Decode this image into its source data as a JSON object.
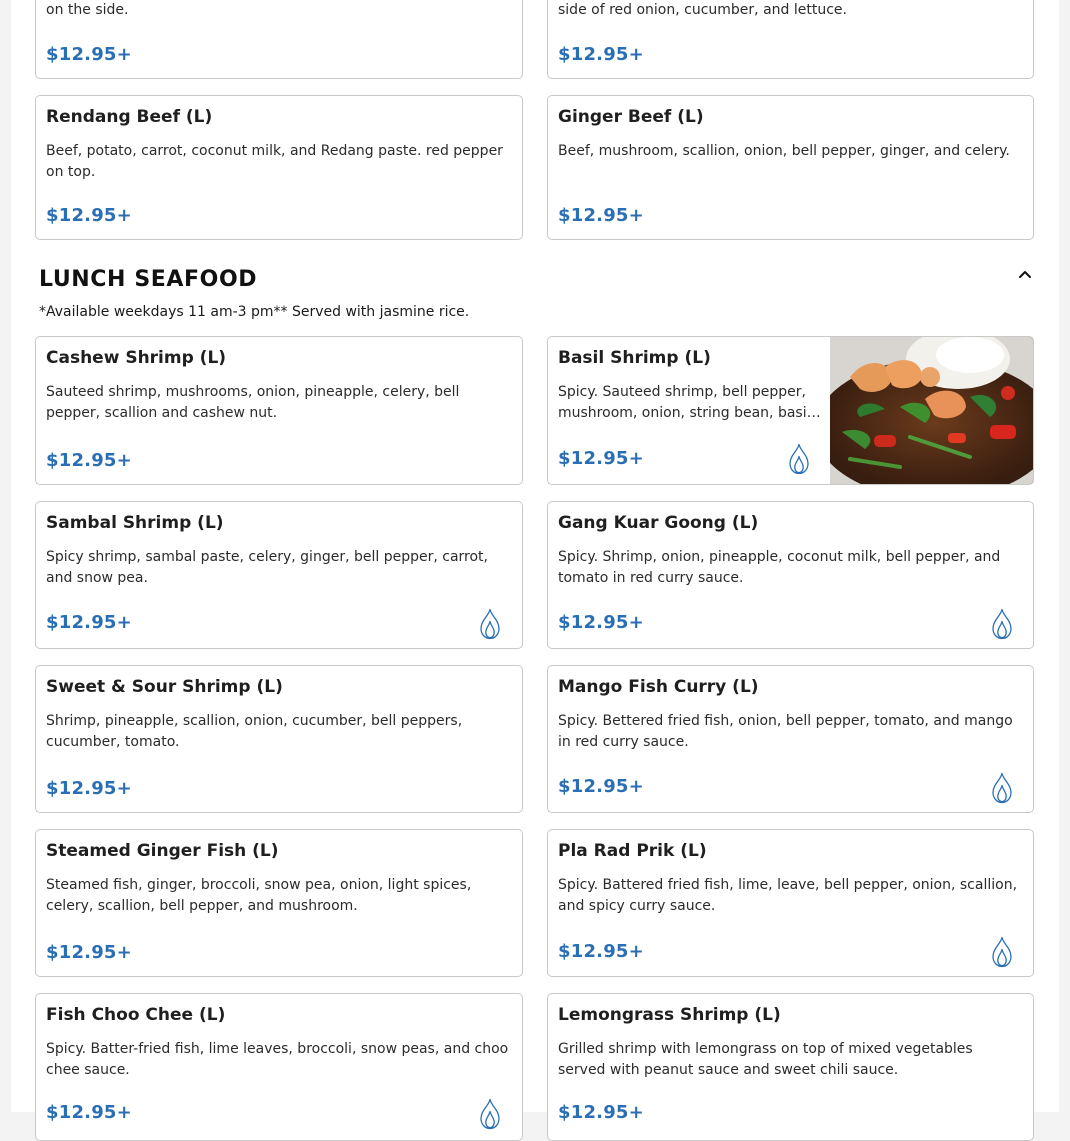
{
  "colors": {
    "price": "#2a6fb5",
    "flame": "#2a6fb5",
    "border": "#c9c9c9"
  },
  "top_items": [
    {
      "description": "on the side.",
      "price": "$12.95+"
    },
    {
      "description": "side of red onion, cucumber, and lettuce.",
      "price": "$12.95+"
    },
    {
      "title": "Rendang Beef (L)",
      "description": "Beef, potato, carrot, coconut milk, and Redang paste. red pepper on top.",
      "price": "$12.95+"
    },
    {
      "title": "Ginger Beef (L)",
      "description": "Beef, mushroom, scallion, onion, bell pepper, ginger, and celery.",
      "price": "$12.95+"
    }
  ],
  "section": {
    "title": "LUNCH SEAFOOD",
    "note": "*Available weekdays 11 am-3 pm** Served with jasmine rice.",
    "collapse_icon": "chevron-up-icon",
    "items": [
      {
        "title": "Cashew Shrimp (L)",
        "description": "Sauteed shrimp, mushrooms, onion, pineapple, celery, bell pepper, scallion and cashew nut.",
        "price": "$12.95+",
        "spicy": false
      },
      {
        "title": "Basil Shrimp (L)",
        "description": "Spicy. Sauteed shrimp, bell pepper, mushroom, onion, string bean, basil leaves.",
        "price": "$12.95+",
        "spicy": true,
        "has_photo": true
      },
      {
        "title": "Sambal Shrimp (L)",
        "description": "Spicy shrimp, sambal paste, celery, ginger, bell pepper, carrot, and snow pea.",
        "price": "$12.95+",
        "spicy": true
      },
      {
        "title": "Gang Kuar Goong (L)",
        "description": "Spicy. Shrimp, onion, pineapple, coconut milk, bell pepper, and tomato in red curry sauce.",
        "price": "$12.95+",
        "spicy": true
      },
      {
        "title": "Sweet & Sour Shrimp (L)",
        "description": "Shrimp, pineapple, scallion, onion, cucumber, bell peppers, cucumber, tomato.",
        "price": "$12.95+",
        "spicy": false
      },
      {
        "title": "Mango Fish Curry (L)",
        "description": "Spicy. Bettered fried fish, onion, bell pepper, tomato, and mango in red curry sauce.",
        "price": "$12.95+",
        "spicy": true
      },
      {
        "title": "Steamed Ginger Fish (L)",
        "description": "Steamed fish, ginger, broccoli, snow pea, onion, light spices, celery, scallion, bell pepper, and mushroom.",
        "price": "$12.95+",
        "spicy": false
      },
      {
        "title": "Pla Rad Prik (L)",
        "description": "Spicy. Battered fried fish, lime, leave, bell pepper, onion, scallion, and spicy curry sauce.",
        "price": "$12.95+",
        "spicy": true
      },
      {
        "title": "Fish Choo Chee (L)",
        "description": "Spicy. Batter-fried fish, lime leaves, broccoli, snow peas, and choo chee sauce.",
        "price": "$12.95+",
        "spicy": true
      },
      {
        "title": "Lemongrass Shrimp (L)",
        "description": "Grilled shrimp with lemongrass on top of mixed vegetables served with peanut sauce and sweet chili sauce.",
        "price": "$12.95+",
        "spicy": false
      }
    ]
  }
}
